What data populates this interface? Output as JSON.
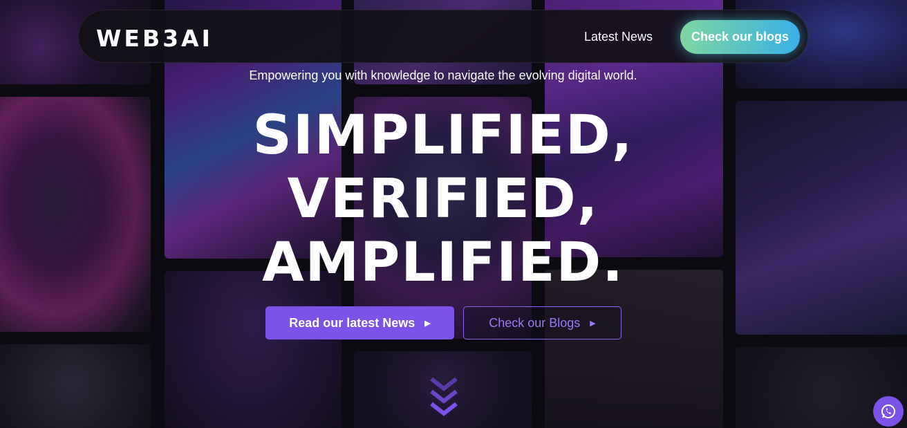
{
  "navbar": {
    "logo": "WEB3AI",
    "latest_news_link": "Latest News",
    "cta_label": "Check our blogs"
  },
  "hero": {
    "tagline": "Empowering you with knowledge to navigate the evolving digital world.",
    "headline_line1": "SIMPLIFIED,",
    "headline_line2": "VERIFIED,",
    "headline_line3": "AMPLIFIED.",
    "primary_button": "Read our latest News",
    "secondary_button": "Check our Blogs"
  },
  "icons": {
    "scroll": "chevrons-down-icon",
    "chat": "whatsapp-icon"
  },
  "colors": {
    "accent": "#7c52e8",
    "cta_gradient_start": "#7ed6a0",
    "cta_gradient_end": "#3ab0e8",
    "background": "#0d0b12"
  }
}
